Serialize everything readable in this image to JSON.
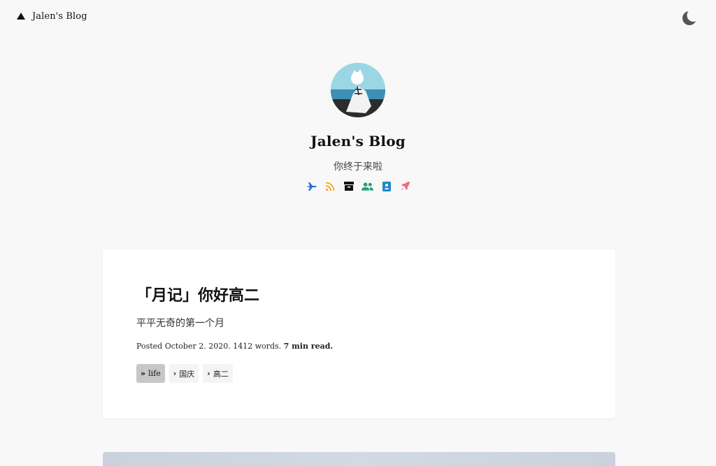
{
  "topbar": {
    "brand_text": "Jalen's Blog",
    "brand_icon": "triangle-logo-icon",
    "theme_toggle_icon": "moon-icon"
  },
  "hero": {
    "avatar_icon": "avatar",
    "title": "Jalen's Blog",
    "subtitle": "你终于来啦",
    "social_icons": [
      {
        "name": "plane-icon",
        "color": "#1e6fe0"
      },
      {
        "name": "rss-icon",
        "color": "#f5a623"
      },
      {
        "name": "archive-icon",
        "color": "#111111"
      },
      {
        "name": "users-icon",
        "color": "#1ea078"
      },
      {
        "name": "contact-card-icon",
        "color": "#1e88c8"
      },
      {
        "name": "rocket-icon",
        "color": "#f06a80"
      }
    ]
  },
  "post": {
    "title": "「月记」你好高二",
    "excerpt": "平平无奇的第一个月",
    "meta_prefix": "Posted October 2. 2020. 1412 words.",
    "meta_readtime": "7 min read.",
    "tags": [
      {
        "label": "life",
        "icon": "double-chevron-right-icon",
        "primary": true
      },
      {
        "label": "国庆",
        "icon": "chevron-right-icon",
        "primary": false
      },
      {
        "label": "高二",
        "icon": "chevron-right-icon",
        "primary": false
      }
    ]
  }
}
